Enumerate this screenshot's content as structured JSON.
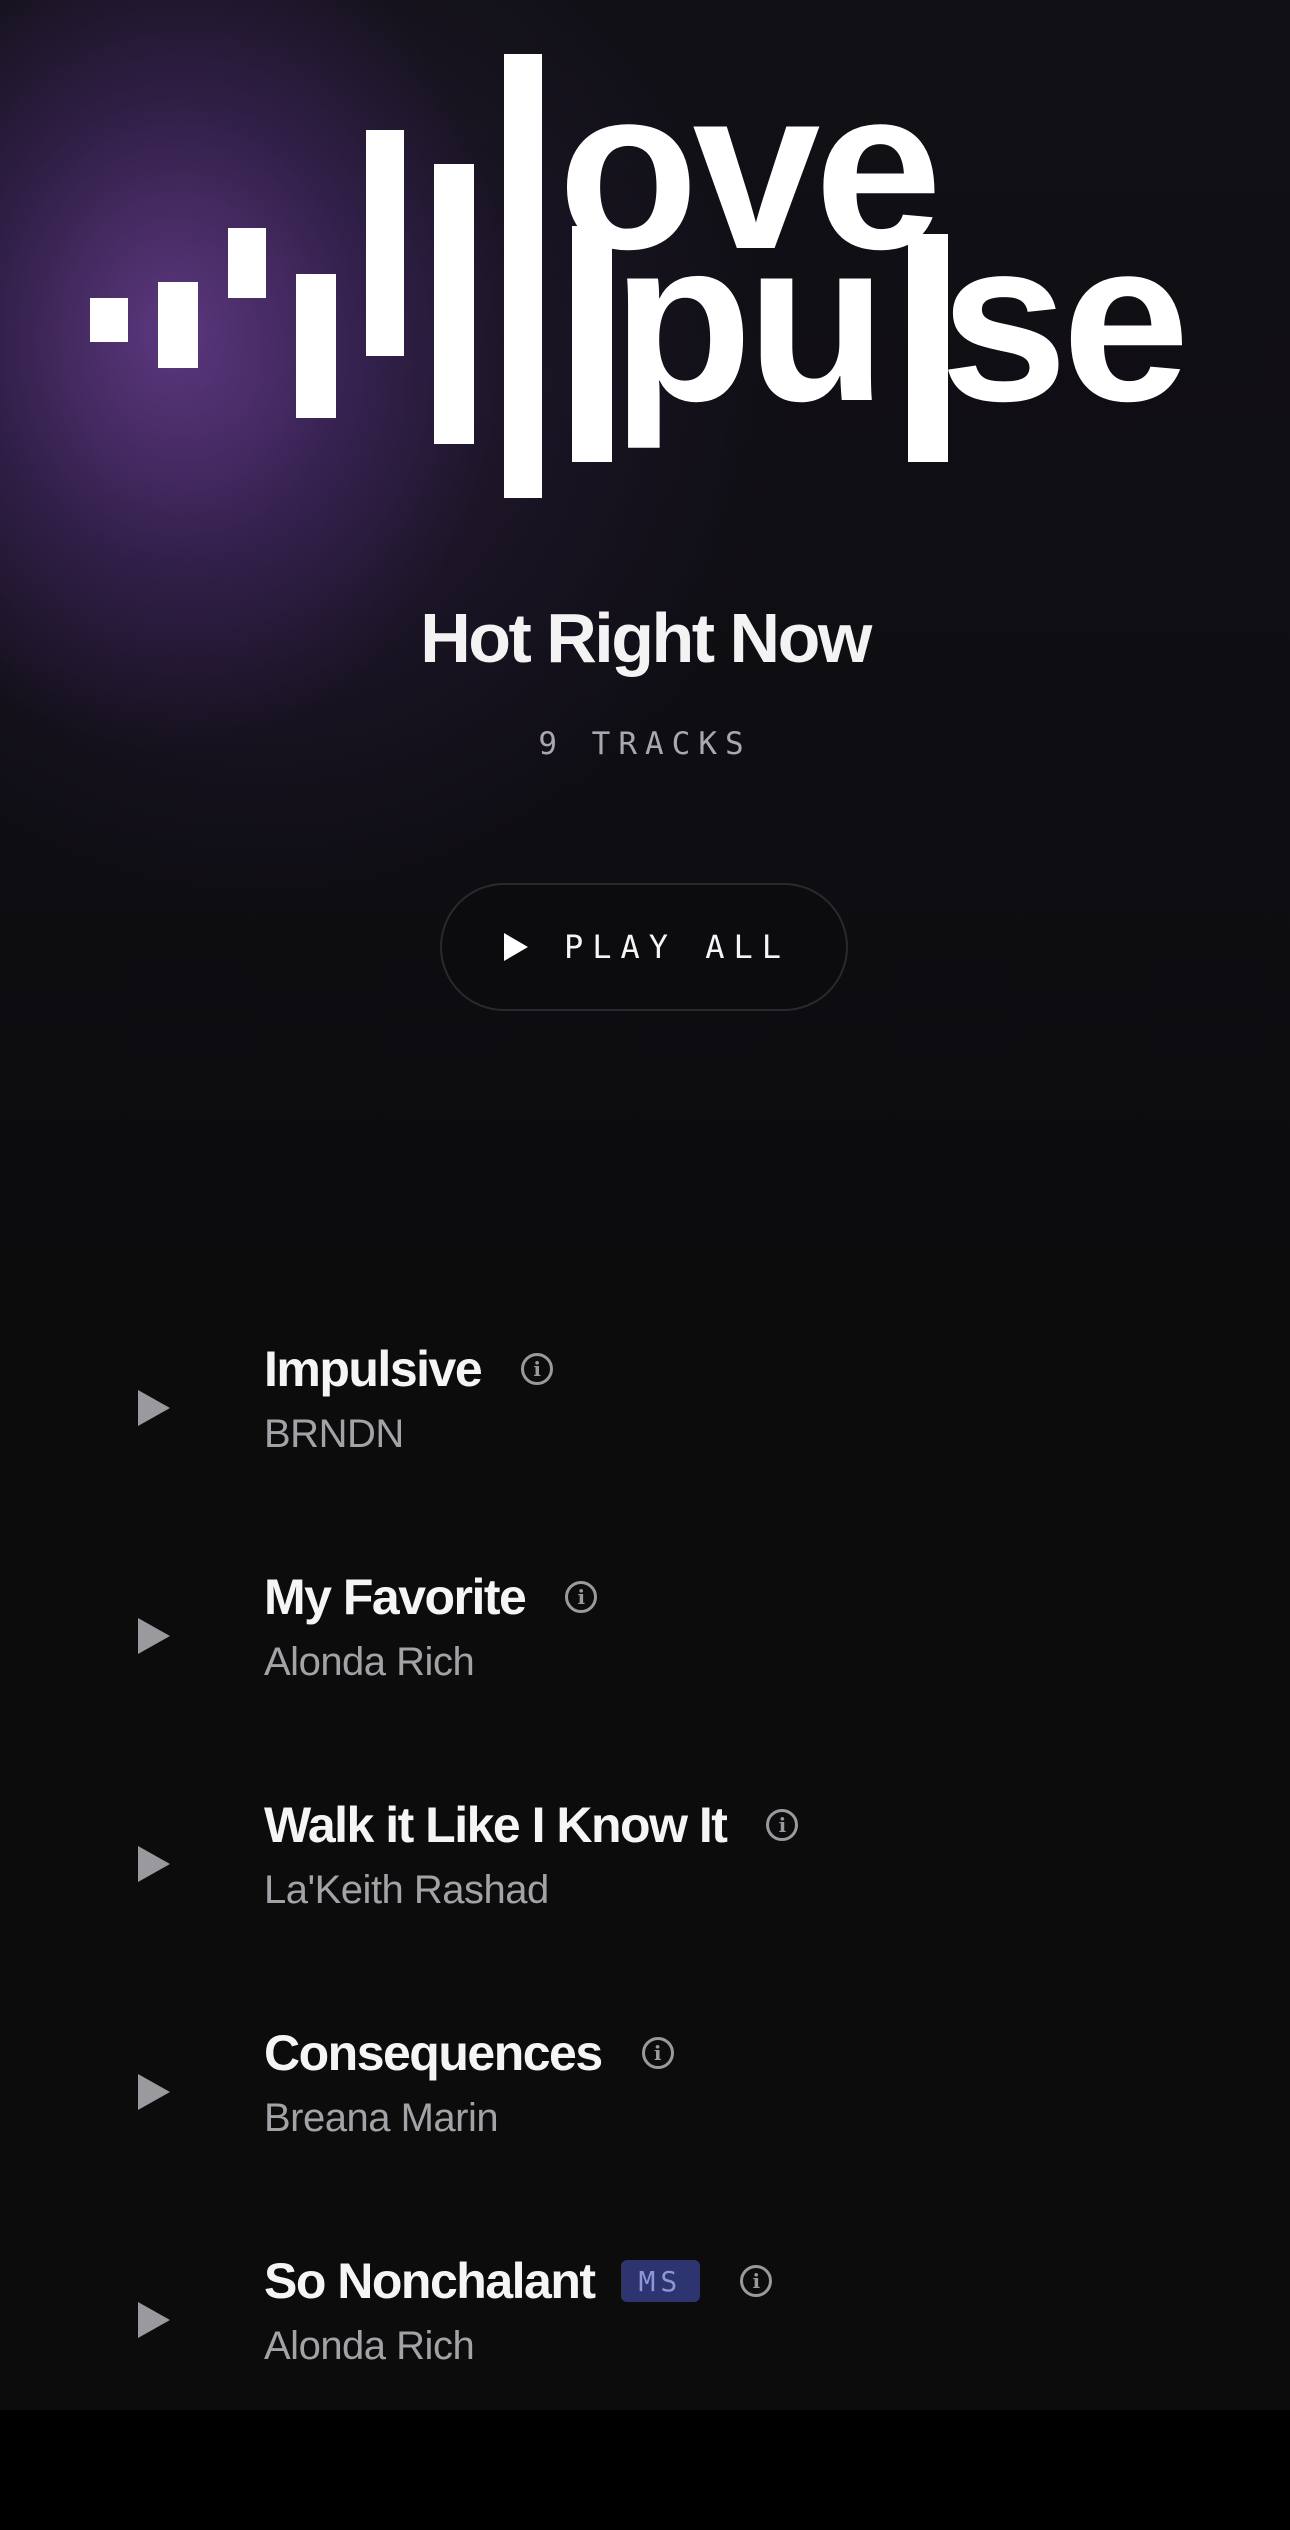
{
  "brand": {
    "logo_word_top": "love",
    "logo_word_bottom": "pulse"
  },
  "playlist": {
    "title": "Hot Right Now",
    "track_count": "9 TRACKS"
  },
  "actions": {
    "play_all_label": "PLAY ALL"
  },
  "tracks": [
    {
      "title": "Impulsive",
      "artist": "BRNDN",
      "badge": ""
    },
    {
      "title": "My Favorite",
      "artist": "Alonda Rich",
      "badge": ""
    },
    {
      "title": "Walk it Like I Know It",
      "artist": "La'Keith Rashad",
      "badge": ""
    },
    {
      "title": "Consequences",
      "artist": "Breana Marin",
      "badge": ""
    },
    {
      "title": "So Nonchalant",
      "artist": "Alonda Rich",
      "badge": "MS"
    }
  ],
  "colors": {
    "background": "#0c0c0d",
    "badge_bg": "#2e3470",
    "badge_text": "#8e96d8",
    "muted_text": "#a3a3a7"
  }
}
